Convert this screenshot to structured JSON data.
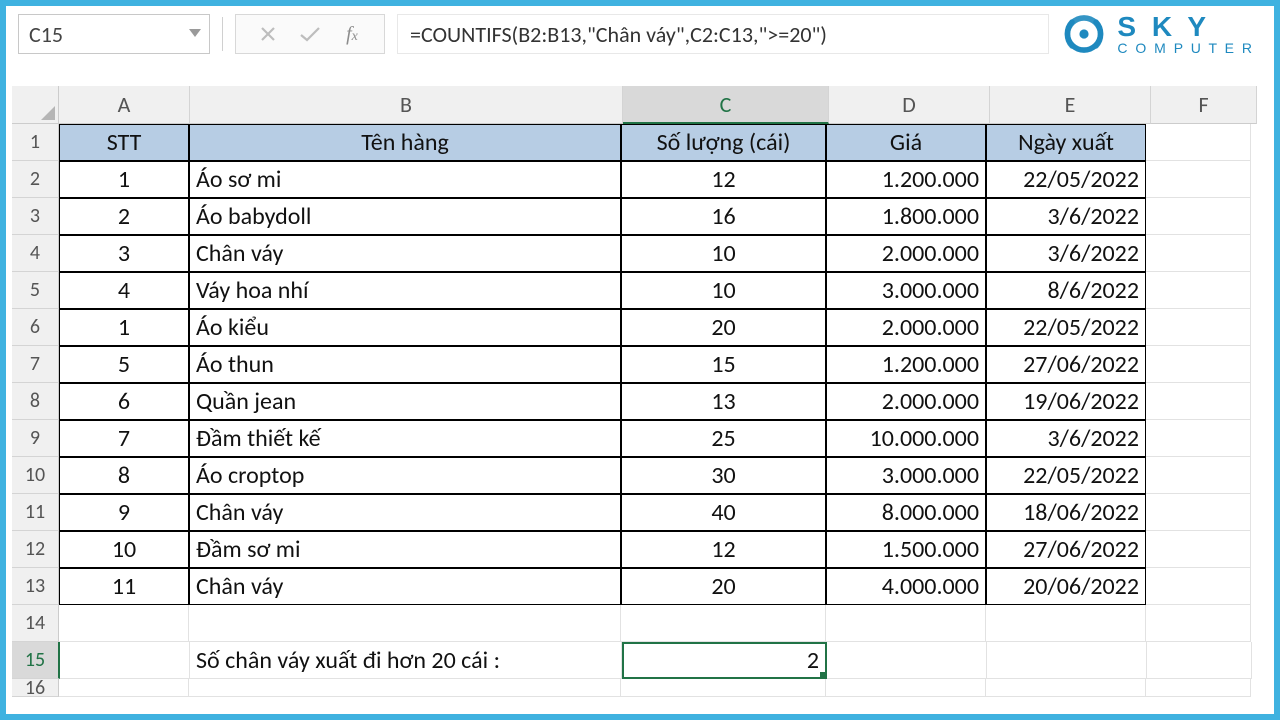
{
  "namebox": "C15",
  "formula": "=COUNTIFS(B2:B13,\"Chân váy\",C2:C13,\">=20\")",
  "logo": {
    "top": "S K Y",
    "bottom": "C O M P U T E R"
  },
  "columns": [
    "A",
    "B",
    "C",
    "D",
    "E",
    "F"
  ],
  "selectedCol": "C",
  "selectedRow": 15,
  "headers": {
    "A": "STT",
    "B": "Tên hàng",
    "C": "Số lượng (cái)",
    "D": "Giá",
    "E": "Ngày xuất"
  },
  "rows": [
    {
      "n": 1,
      "A": "1",
      "B": "Áo sơ mi",
      "C": "12",
      "D": "1.200.000",
      "E": "22/05/2022"
    },
    {
      "n": 2,
      "A": "2",
      "B": "Áo babydoll",
      "C": "16",
      "D": "1.800.000",
      "E": "3/6/2022"
    },
    {
      "n": 3,
      "A": "3",
      "B": "Chân váy",
      "C": "10",
      "D": "2.000.000",
      "E": "3/6/2022"
    },
    {
      "n": 4,
      "A": "4",
      "B": "Váy hoa nhí",
      "C": "10",
      "D": "3.000.000",
      "E": "8/6/2022"
    },
    {
      "n": 5,
      "A": "1",
      "B": "Áo kiểu",
      "C": "20",
      "D": "2.000.000",
      "E": "22/05/2022"
    },
    {
      "n": 6,
      "A": "5",
      "B": "Áo thun",
      "C": "15",
      "D": "1.200.000",
      "E": "27/06/2022"
    },
    {
      "n": 7,
      "A": "6",
      "B": "Quần jean",
      "C": "13",
      "D": "2.000.000",
      "E": "19/06/2022"
    },
    {
      "n": 8,
      "A": "7",
      "B": "Đầm thiết kế",
      "C": "25",
      "D": "10.000.000",
      "E": "3/6/2022"
    },
    {
      "n": 9,
      "A": "8",
      "B": "Áo croptop",
      "C": "30",
      "D": "3.000.000",
      "E": "22/05/2022"
    },
    {
      "n": 10,
      "A": "9",
      "B": "Chân váy",
      "C": "40",
      "D": "8.000.000",
      "E": "18/06/2022"
    },
    {
      "n": 11,
      "A": "10",
      "B": "Đầm sơ mi",
      "C": "12",
      "D": "1.500.000",
      "E": "27/06/2022"
    },
    {
      "n": 12,
      "A": "11",
      "B": "Chân váy",
      "C": "20",
      "D": "4.000.000",
      "E": "20/06/2022"
    }
  ],
  "summary": {
    "label": "Số chân váy xuất đi hơn 20 cái :",
    "value": "2"
  },
  "colors": {
    "accent": "#3fb2e0",
    "excelGreen": "#217346",
    "headerFill": "#b7cde4",
    "logo": "#1e89bf"
  }
}
